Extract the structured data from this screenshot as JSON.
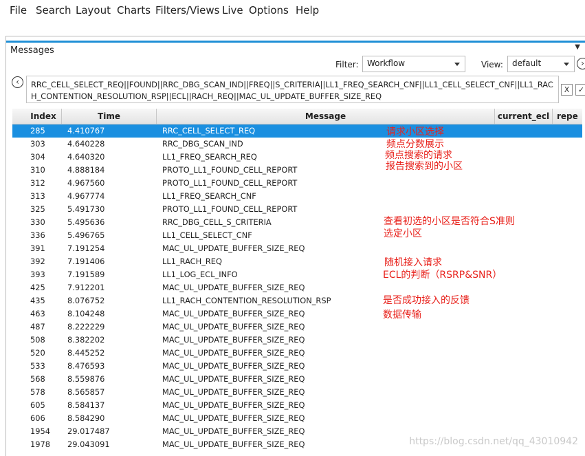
{
  "menu": [
    "File",
    "Search",
    "Layout",
    "Charts",
    "Filters/Views",
    "Live",
    "Options",
    "Help"
  ],
  "panel": {
    "title": "Messages",
    "pin_glyph": "▼"
  },
  "filter": {
    "label": "Filter:",
    "value": "Workflow"
  },
  "view": {
    "label": "View:",
    "value": "default"
  },
  "filter_expression": "RRC_CELL_SELECT_REQ||FOUND||RRC_DBG_SCAN_IND||FREQ||S_CRITERIA||LL1_FREQ_SEARCH_CNF||LL1_CELL_SELECT_CNF||LL1_RACH_CONTENTION_RESOLUTION_RSP||ECL||RACH_REQ||MAC_UL_UPDATE_BUFFER_SIZE_REQ",
  "buttons": {
    "back": "‹",
    "forward": "›",
    "clear": "X",
    "apply": "✓"
  },
  "columns": [
    "Index",
    "Time",
    "Message",
    "current_ecl",
    "repe"
  ],
  "rows": [
    {
      "index": "285",
      "time": "4.410767",
      "message": "RRC_CELL_SELECT_REQ"
    },
    {
      "index": "303",
      "time": "4.640228",
      "message": "RRC_DBG_SCAN_IND"
    },
    {
      "index": "304",
      "time": "4.640320",
      "message": "LL1_FREQ_SEARCH_REQ"
    },
    {
      "index": "310",
      "time": "4.888184",
      "message": "PROTO_LL1_FOUND_CELL_REPORT"
    },
    {
      "index": "312",
      "time": "4.967560",
      "message": "PROTO_LL1_FOUND_CELL_REPORT"
    },
    {
      "index": "313",
      "time": "4.967774",
      "message": "LL1_FREQ_SEARCH_CNF"
    },
    {
      "index": "325",
      "time": "5.491730",
      "message": "PROTO_LL1_FOUND_CELL_REPORT"
    },
    {
      "index": "330",
      "time": "5.495636",
      "message": "RRC_DBG_CELL_S_CRITERIA"
    },
    {
      "index": "336",
      "time": "5.496765",
      "message": "LL1_CELL_SELECT_CNF"
    },
    {
      "index": "391",
      "time": "7.191254",
      "message": "MAC_UL_UPDATE_BUFFER_SIZE_REQ"
    },
    {
      "index": "392",
      "time": "7.191406",
      "message": "LL1_RACH_REQ"
    },
    {
      "index": "393",
      "time": "7.191589",
      "message": "LL1_LOG_ECL_INFO"
    },
    {
      "index": "425",
      "time": "7.912201",
      "message": "MAC_UL_UPDATE_BUFFER_SIZE_REQ"
    },
    {
      "index": "435",
      "time": "8.076752",
      "message": "LL1_RACH_CONTENTION_RESOLUTION_RSP"
    },
    {
      "index": "463",
      "time": "8.104248",
      "message": "MAC_UL_UPDATE_BUFFER_SIZE_REQ"
    },
    {
      "index": "487",
      "time": "8.222229",
      "message": "MAC_UL_UPDATE_BUFFER_SIZE_REQ"
    },
    {
      "index": "508",
      "time": "8.382202",
      "message": "MAC_UL_UPDATE_BUFFER_SIZE_REQ"
    },
    {
      "index": "520",
      "time": "8.445252",
      "message": "MAC_UL_UPDATE_BUFFER_SIZE_REQ"
    },
    {
      "index": "533",
      "time": "8.476593",
      "message": "MAC_UL_UPDATE_BUFFER_SIZE_REQ"
    },
    {
      "index": "568",
      "time": "8.559876",
      "message": "MAC_UL_UPDATE_BUFFER_SIZE_REQ"
    },
    {
      "index": "578",
      "time": "8.565857",
      "message": "MAC_UL_UPDATE_BUFFER_SIZE_REQ"
    },
    {
      "index": "605",
      "time": "8.584137",
      "message": "MAC_UL_UPDATE_BUFFER_SIZE_REQ"
    },
    {
      "index": "606",
      "time": "8.584290",
      "message": "MAC_UL_UPDATE_BUFFER_SIZE_REQ"
    },
    {
      "index": "1954",
      "time": "29.017487",
      "message": "MAC_UL_UPDATE_BUFFER_SIZE_REQ"
    },
    {
      "index": "1978",
      "time": "29.043091",
      "message": "MAC_UL_UPDATE_BUFFER_SIZE_REQ"
    }
  ],
  "selected_row": 0,
  "annotations": [
    "请求小区选择",
    "频点分数展示",
    "频点搜索的请求",
    "报告搜索到的小区",
    "查看初选的小区是否符合S准则",
    "选定小区",
    "随机接入请求",
    "ECL的判断（RSRP&SNR）",
    "是否成功接入的反馈",
    "数据传输"
  ],
  "watermark": "https://blog.csdn.net/qq_43010942",
  "colors": {
    "accent": "#1f8fd6",
    "selection": "#1a8fe0",
    "annotation": "#e8211b"
  }
}
